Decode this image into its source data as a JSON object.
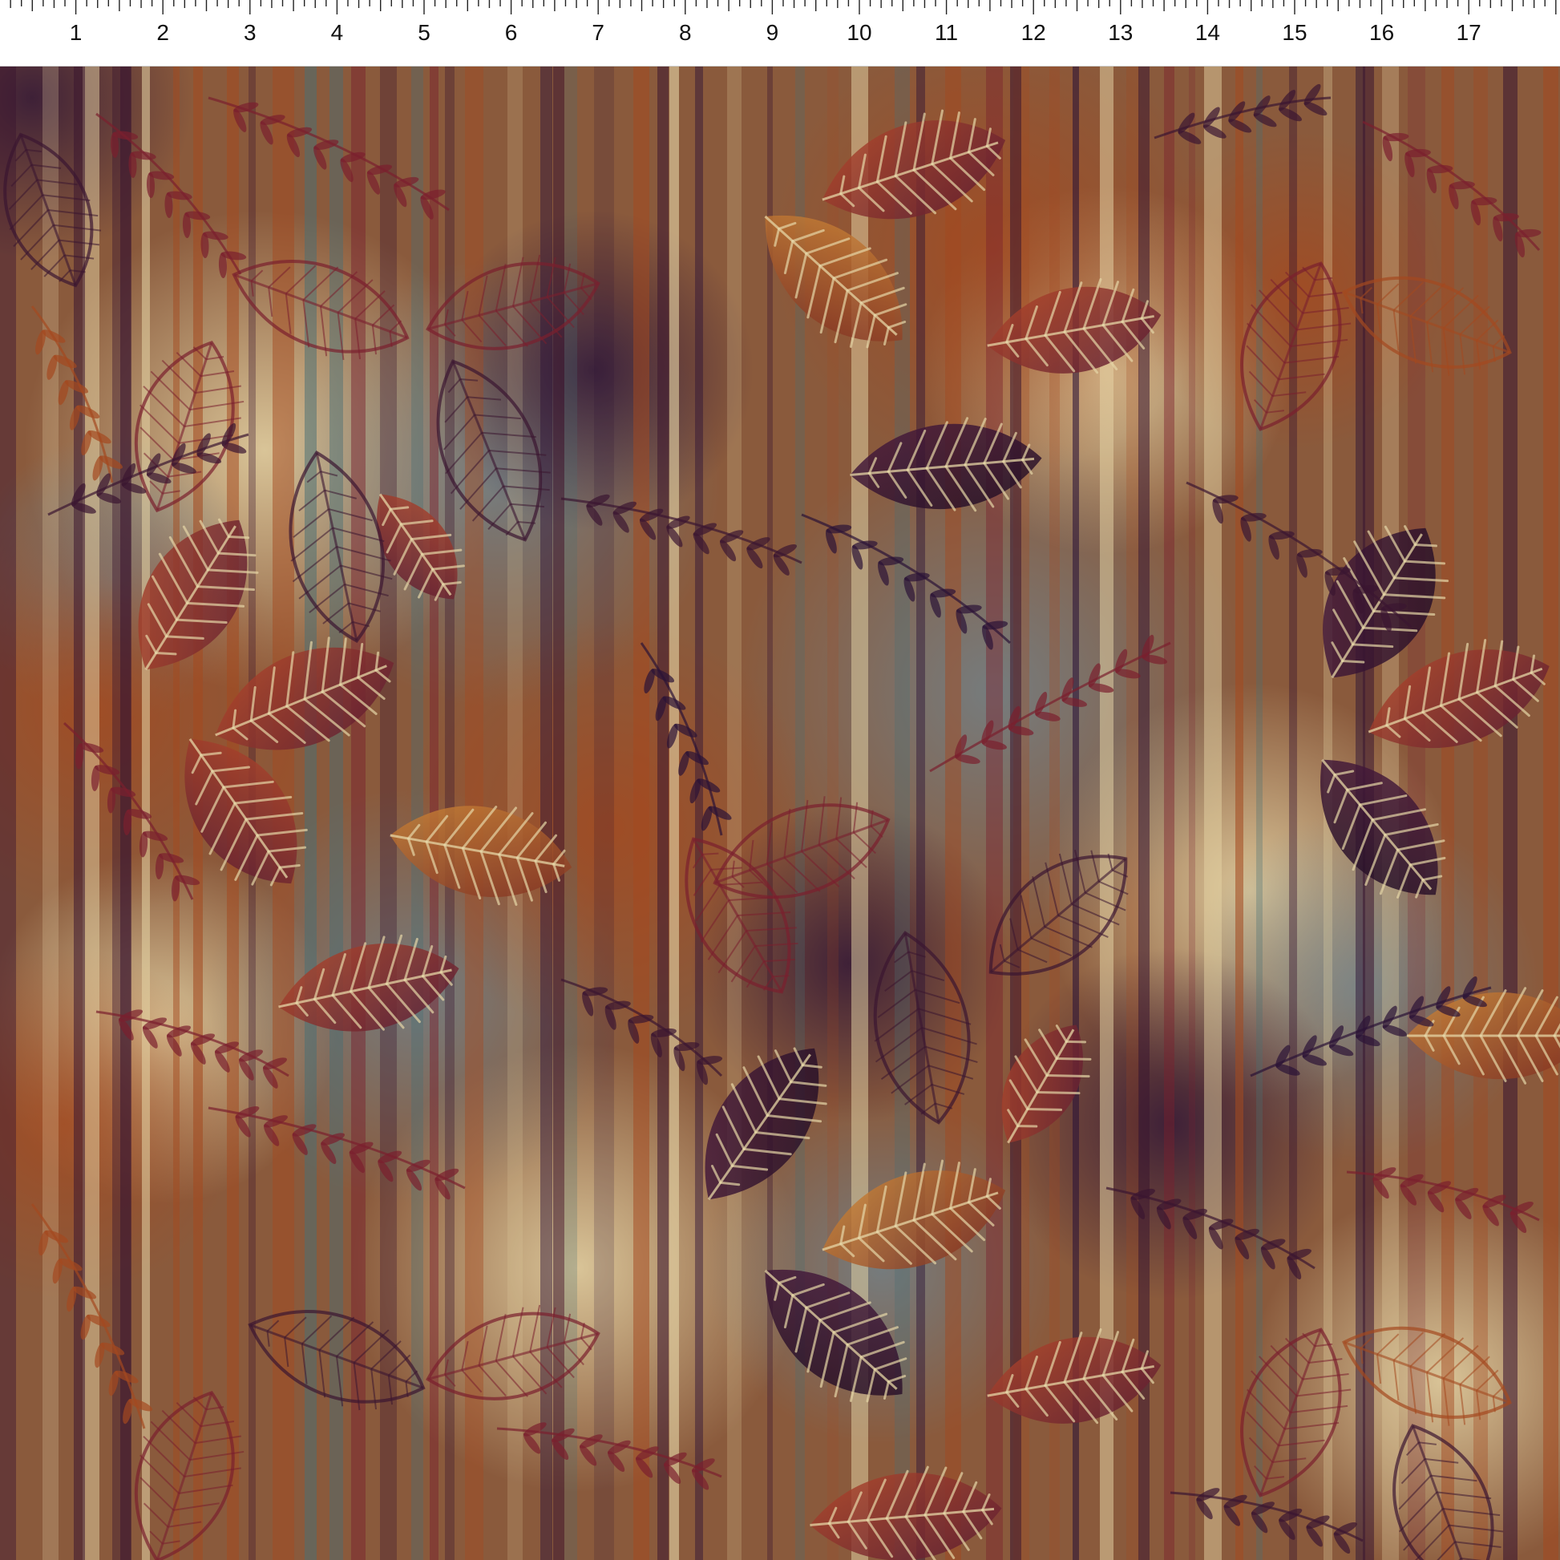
{
  "ruler": {
    "unit_labels": [
      "1",
      "2",
      "3",
      "4",
      "5",
      "6",
      "7",
      "8",
      "9",
      "10",
      "11",
      "12",
      "13",
      "14",
      "15",
      "16",
      "17"
    ]
  },
  "fabric": {
    "description_icon": "leaf-stripe-batik-pattern",
    "colors": {
      "deep_plum": "#3a1530",
      "wine": "#7a1f2e",
      "rust": "#a4491f",
      "amber": "#c98a35",
      "cream": "#e6d5a6",
      "slate": "#6f8793",
      "teal": "#496f74",
      "aubergine": "#2b1236"
    }
  }
}
